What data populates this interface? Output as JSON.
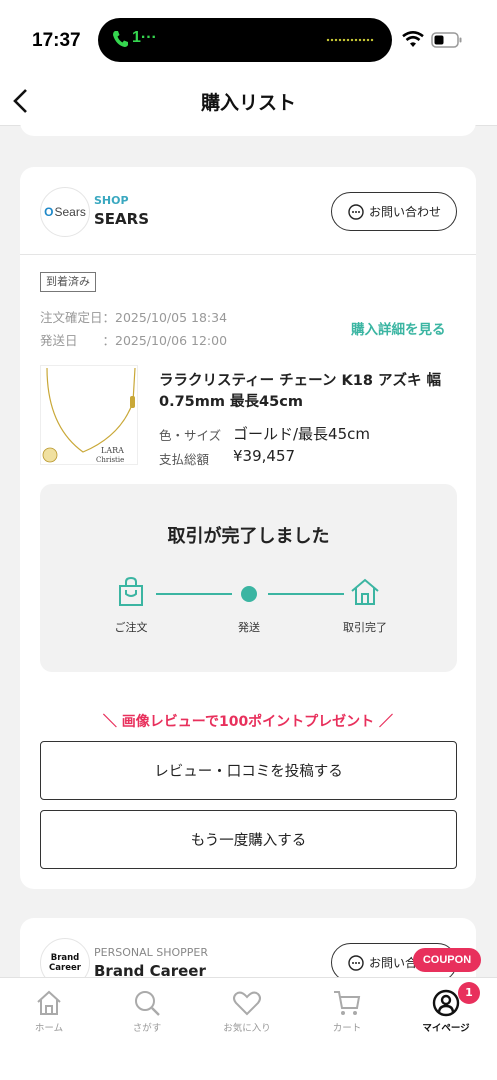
{
  "status_bar": {
    "time": "17:37",
    "call": "1···"
  },
  "nav": {
    "title": "購入リスト"
  },
  "order": {
    "shop_tag": "SHOP",
    "shop_name": "SEARS",
    "shop_logo_text": "Sears",
    "inquiry_label": "お問い合わせ",
    "status_badge": "到着済み",
    "order_date": "注文確定日：2025/10/05 18:34",
    "ship_date": "発送日　　：2025/10/06 12:00",
    "detail_link": "購入詳細を見る",
    "product_name": "ララクリスティー チェーン K18 アズキ 幅0.75mm 最長45cm",
    "product_image_text": "LARA Christie",
    "variant_label": "色・サイズ",
    "variant_value": "ゴールド/最長45cm",
    "total_label": "支払総額",
    "total_value": "¥39,457",
    "status_title": "取引が完了しました",
    "steps": [
      "ご注文",
      "発送",
      "取引完了"
    ],
    "promo": "＼ 画像レビューで100ポイントプレゼント ／",
    "review_button": "レビュー・口コミを投稿する",
    "rebuy_button": "もう一度購入する"
  },
  "next_order": {
    "shop_tag": "PERSONAL SHOPPER",
    "shop_name": "Brand Career",
    "logo_line1": "Brand",
    "logo_line2": "Career",
    "inquiry_label": "お問い合わせ"
  },
  "coupon_label": "COUPON",
  "tabbar": {
    "home": "ホーム",
    "search": "さがす",
    "favorites": "お気に入り",
    "cart": "カート",
    "mypage": "マイページ",
    "mypage_badge": "1"
  },
  "colors": {
    "accent": "#3bb5a2",
    "promo": "#e8305c",
    "shop_tag": "#3aa8c0"
  }
}
